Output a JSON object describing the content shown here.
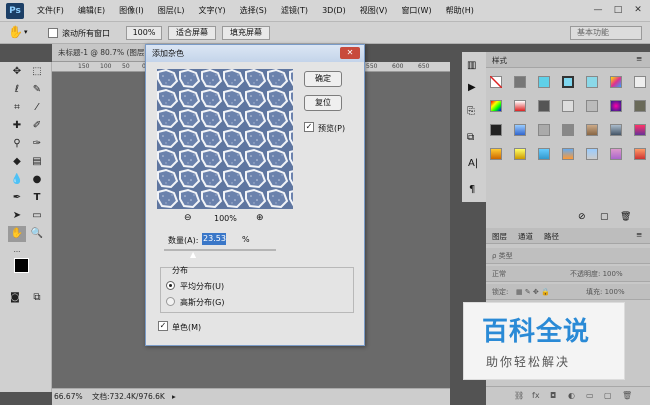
{
  "menubar": {
    "logo": "Ps",
    "items": [
      "文件(F)",
      "编辑(E)",
      "图像(I)",
      "图层(L)",
      "文字(Y)",
      "选择(S)",
      "滤镜(T)",
      "3D(D)",
      "视图(V)",
      "窗口(W)",
      "帮助(H)"
    ],
    "min": "—",
    "max": "□",
    "close": "✕"
  },
  "options": {
    "scroll_all": "滚动所有窗口",
    "zoom": "100%",
    "fit_screen": "适合屏幕",
    "fill_screen": "填充屏幕",
    "workspace": "基本功能"
  },
  "document": {
    "tab_title": "未标题-1 @ 80.7% (图层",
    "ruler_ticks": [
      "150",
      "100",
      "50",
      "0"
    ],
    "ruler_ticks_right": [
      "550",
      "600",
      "650"
    ],
    "zoom_status": "66.67%",
    "doc_info": "文档:732.4K/976.6K"
  },
  "dialog": {
    "title": "添加杂色",
    "ok": "确定",
    "reset": "复位",
    "preview_label": "预览(P)",
    "zoom_value": "100%",
    "amount_label": "数量(A):",
    "amount_value": "23.53",
    "amount_unit": "%",
    "distribution_title": "分布",
    "uniform": "平均分布(U)",
    "gaussian": "高斯分布(G)",
    "monochrome": "单色(M)"
  },
  "styles_panel": {
    "title": "样式"
  },
  "layers_panel": {
    "tabs": [
      "图层",
      "通道",
      "路径"
    ],
    "kind": "ρ 类型",
    "blend": "正常",
    "opacity": "不透明度: 100%",
    "lock": "锁定:",
    "fill": "填充: 100%"
  },
  "watermark": {
    "title": "百科全说",
    "subtitle": "助你轻松解决"
  },
  "colors": {
    "accent": "#3a77c8",
    "wm_blue": "#2a8ad6",
    "wm_green": "#3aa33a"
  }
}
